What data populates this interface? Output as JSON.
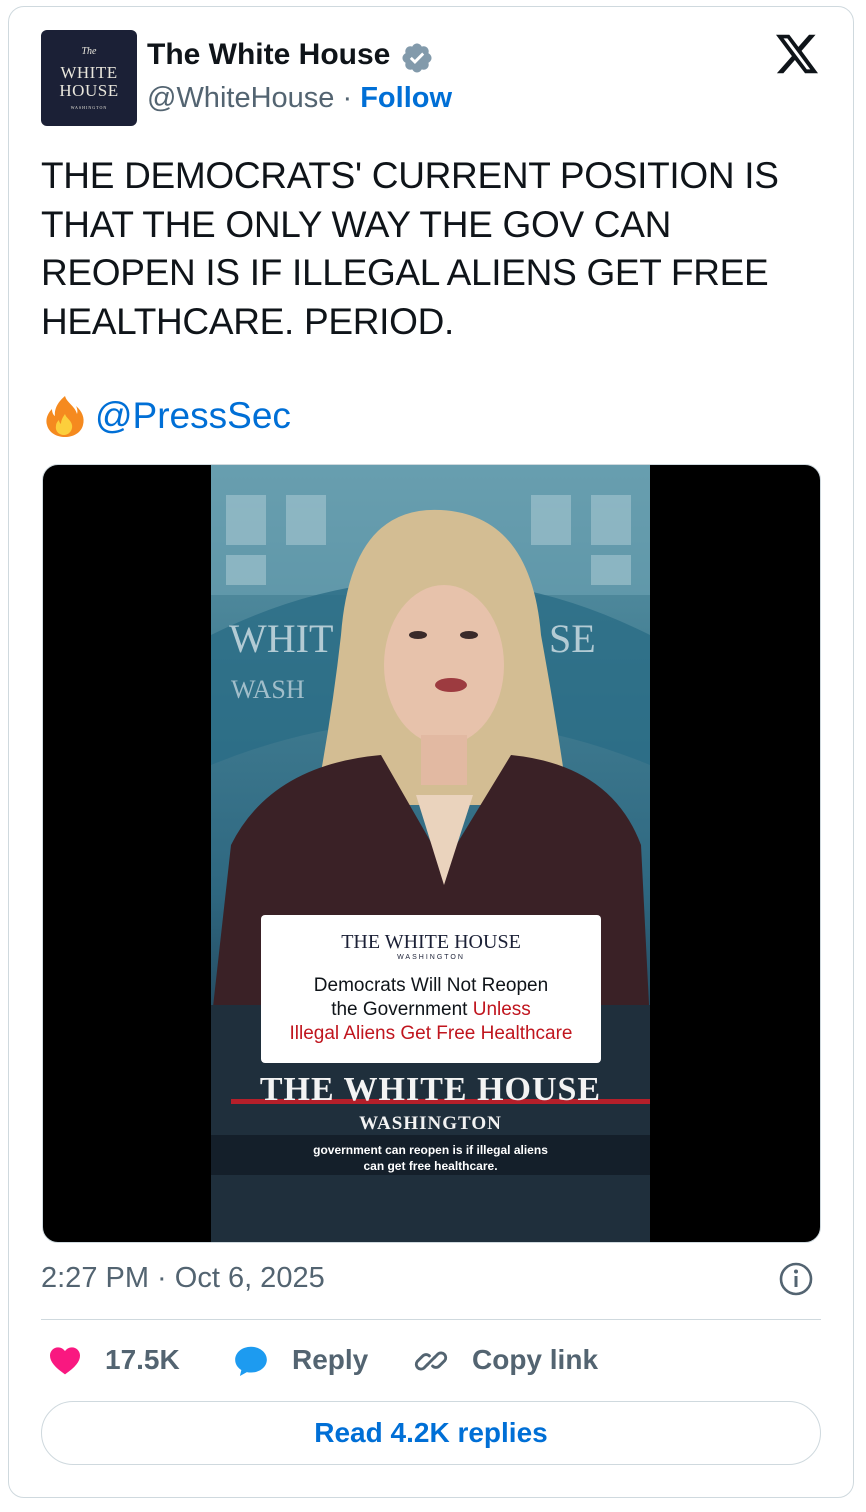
{
  "tweet": {
    "author": {
      "name": "The White House",
      "handle": "@WhiteHouse",
      "separator": "·",
      "follow_label": "Follow",
      "avatar_text": {
        "line0": "The",
        "line1": "WHITE",
        "line2": "HOUSE",
        "line3": "WASHINGTON"
      }
    },
    "text": "THE DEMOCRATS' CURRENT POSITION IS THAT THE ONLY WAY THE GOV CAN REOPEN IS IF ILLEGAL ALIENS GET FREE HEALTHCARE. PERIOD.",
    "mention_emoji": "fire-icon",
    "mention": "@PressSec",
    "media": {
      "background_text": {
        "left": "WHIT",
        "right": "SE",
        "second": "WASH"
      },
      "lower_third": {
        "title": "THE WHITE HOUSE",
        "subtitle": "WASHINGTON",
        "line1": "Democrats Will Not Reopen",
        "line2_prefix": "the Government ",
        "line2_highlight": "Unless",
        "line3": "Illegal Aliens Get Free Healthcare"
      },
      "podium_title": "THE WHITE HOUSE",
      "podium_subtitle": "WASHINGTON",
      "caption_line1": "government can reopen is if illegal aliens",
      "caption_line2": "can get free healthcare."
    },
    "timestamp": "2:27 PM · Oct 6, 2025",
    "actions": {
      "likes": "17.5K",
      "reply_label": "Reply",
      "copy_label": "Copy link"
    },
    "read_replies_label": "Read 4.2K replies"
  },
  "colors": {
    "link_blue": "#006fd6",
    "like_pink": "#f91880",
    "reply_blue": "#1d9bf0",
    "muted": "#536471",
    "verified_gray": "#829aab"
  }
}
